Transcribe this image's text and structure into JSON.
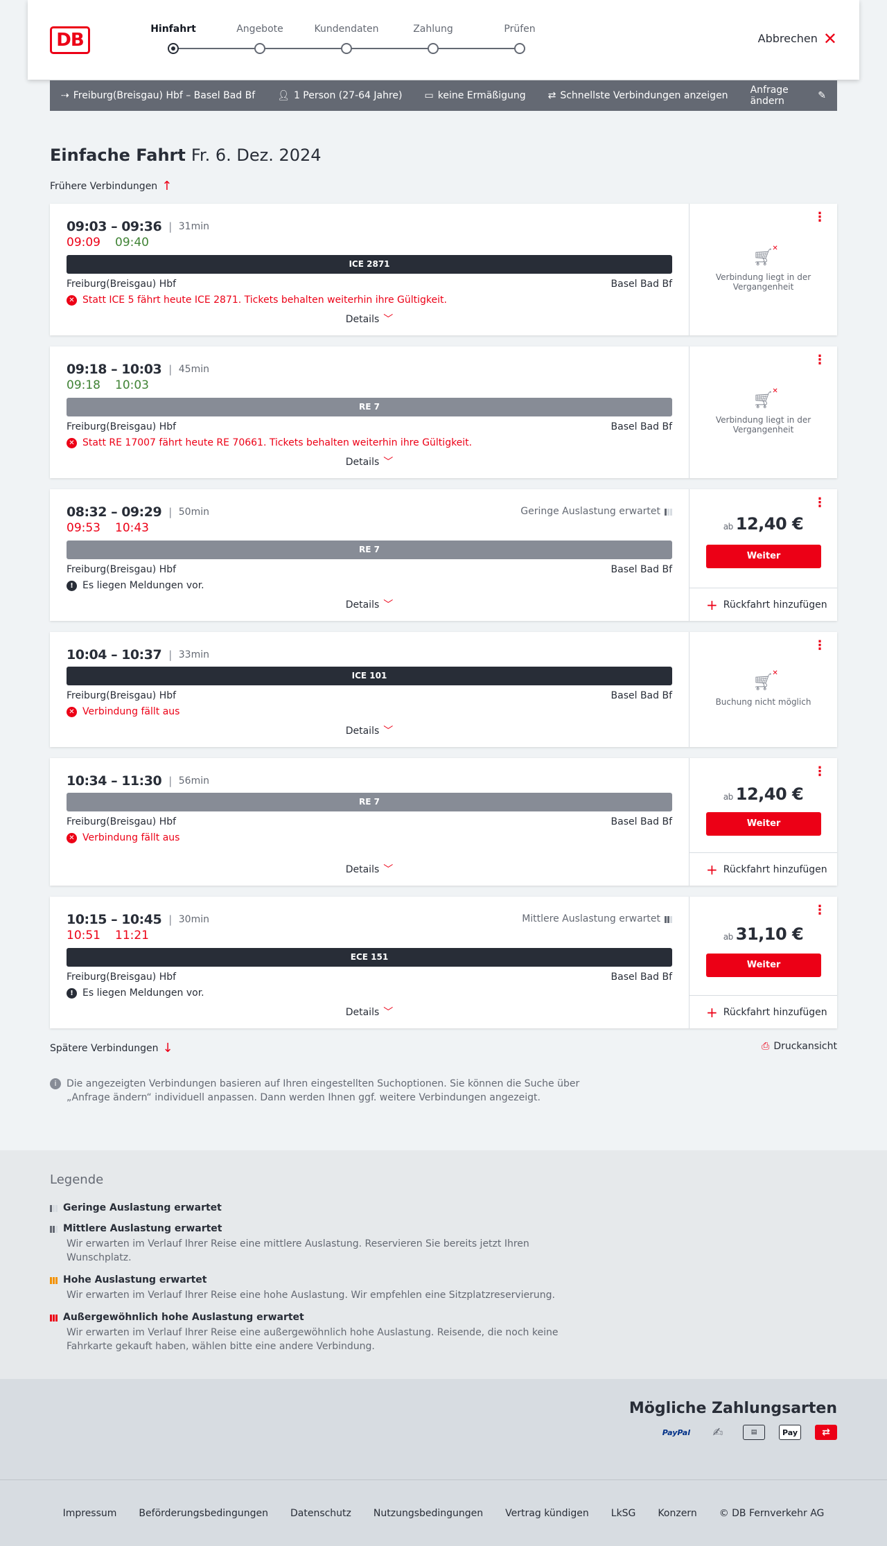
{
  "header": {
    "logo": "DB",
    "steps": [
      "Hinfahrt",
      "Angebote",
      "Kundendaten",
      "Zahlung",
      "Prüfen"
    ],
    "cancel_label": "Abbrechen"
  },
  "query": {
    "route": "Freiburg(Breisgau) Hbf – Basel Bad Bf",
    "persons": "1 Person (27-64 Jahre)",
    "discount": "keine Ermäßigung",
    "fastest": "Schnellste Verbindungen anzeigen",
    "change": "Anfrage ändern"
  },
  "title": {
    "type": "Einfache Fahrt",
    "date": "Fr. 6. Dez. 2024"
  },
  "earlier_label": "Frühere Verbindungen",
  "later_label": "Spätere Verbindungen",
  "print_label": "Druckansicht",
  "connections": [
    {
      "times": "09:03 – 09:36",
      "duration": "31min",
      "rt_dep": "09:09",
      "rt_arr": "09:40",
      "train": "ICE 2871",
      "from": "Freiburg(Breisgau) Hbf",
      "to": "Basel Bad Bf",
      "message": "Statt ICE 5 fährt heute ICE 2871. Tickets behalten weiterhin ihre Gültigkeit.",
      "details": "Details",
      "status": "Verbindung liegt in der Vergangenheit"
    },
    {
      "times": "09:18 – 10:03",
      "duration": "45min",
      "rt_dep": "09:18",
      "rt_arr": "10:03",
      "train": "RE 7",
      "from": "Freiburg(Breisgau) Hbf",
      "to": "Basel Bad Bf",
      "message": "Statt RE 17007 fährt heute RE 70661. Tickets behalten weiterhin ihre Gültigkeit.",
      "details": "Details",
      "status": "Verbindung liegt in der Vergangenheit"
    },
    {
      "times": "08:32 – 09:29",
      "duration": "50min",
      "load": "Geringe Auslastung erwartet",
      "rt_dep": "09:53",
      "rt_arr": "10:43",
      "train": "RE 7",
      "from": "Freiburg(Breisgau) Hbf",
      "to": "Basel Bad Bf",
      "message": "Es liegen Meldungen vor.",
      "details": "Details",
      "price_prefix": "ab",
      "price": "12,40 €",
      "button": "Weiter",
      "return": "Rückfahrt hinzufügen"
    },
    {
      "times": "10:04 – 10:37",
      "duration": "33min",
      "train": "ICE 101",
      "from": "Freiburg(Breisgau) Hbf",
      "to": "Basel Bad Bf",
      "message": "Verbindung fällt aus",
      "details": "Details",
      "status": "Buchung nicht möglich"
    },
    {
      "times": "10:34 – 11:30",
      "duration": "56min",
      "train": "RE 7",
      "from": "Freiburg(Breisgau) Hbf",
      "to": "Basel Bad Bf",
      "message": "Verbindung fällt aus",
      "details": "Details",
      "price_prefix": "ab",
      "price": "12,40 €",
      "button": "Weiter",
      "return": "Rückfahrt hinzufügen"
    },
    {
      "times": "10:15 – 10:45",
      "duration": "30min",
      "load": "Mittlere Auslastung erwartet",
      "rt_dep": "10:51",
      "rt_arr": "11:21",
      "train": "ECE 151",
      "from": "Freiburg(Breisgau) Hbf",
      "to": "Basel Bad Bf",
      "message": "Es liegen Meldungen vor.",
      "details": "Details",
      "price_prefix": "ab",
      "price": "31,10 €",
      "button": "Weiter",
      "return": "Rückfahrt hinzufügen"
    }
  ],
  "note": "Die angezeigten Verbindungen basieren auf Ihren eingestellten Suchoptionen. Sie können die Suche über „Anfrage ändern“ individuell anpassen. Dann werden Ihnen ggf. weitere Verbindungen angezeigt.",
  "legend": {
    "title": "Legende",
    "items": [
      {
        "title": "Geringe Auslastung erwartet",
        "desc": ""
      },
      {
        "title": "Mittlere Auslastung erwartet",
        "desc": "Wir erwarten im Verlauf Ihrer Reise eine mittlere Auslastung. Reservieren Sie bereits jetzt Ihren Wunschplatz."
      },
      {
        "title": "Hohe Auslastung erwartet",
        "desc": "Wir erwarten im Verlauf Ihrer Reise eine hohe Auslastung. Wir empfehlen eine Sitzplatzreservierung."
      },
      {
        "title": "Außergewöhnlich hohe Auslastung erwartet",
        "desc": "Wir erwarten im Verlauf Ihrer Reise eine außergewöhnlich hohe Auslastung. Reisende, die noch keine Fahrkarte gekauft haben, wählen bitte eine andere Verbindung."
      }
    ]
  },
  "payments": {
    "title": "Mögliche Zahlungsarten",
    "logos": [
      "PayPal",
      "Pay"
    ]
  },
  "footer": [
    "Impressum",
    "Beförderungsbedingungen",
    "Datenschutz",
    "Nutzungsbedingungen",
    "Vertrag kündigen",
    "LkSG",
    "Konzern",
    "© DB Fernverkehr AG"
  ],
  "colors": {
    "accent": "#ec0016",
    "dark": "#282d37",
    "grey_bar": "#878c96",
    "green": "#408335"
  }
}
